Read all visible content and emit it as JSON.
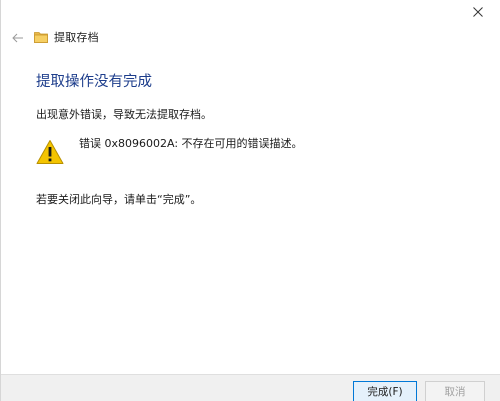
{
  "window": {
    "title": "提取存档",
    "close_label": "×"
  },
  "icons": {
    "back": "back-arrow-icon",
    "folder": "folder-icon",
    "warning": "warning-icon",
    "close": "close-icon"
  },
  "main": {
    "heading": "提取操作没有完成",
    "message": "出现意外错误，导致无法提取存档。",
    "error": "错误 0x8096002A: 不存在可用的错误描述。",
    "instruction": "若要关闭此向导，请单击“完成”。"
  },
  "footer": {
    "finish_label": "完成(F)",
    "cancel_label": "取消"
  },
  "colors": {
    "heading": "#1e3e8c",
    "warning_fill": "#f4c400",
    "button_focus_border": "#0078d7"
  }
}
